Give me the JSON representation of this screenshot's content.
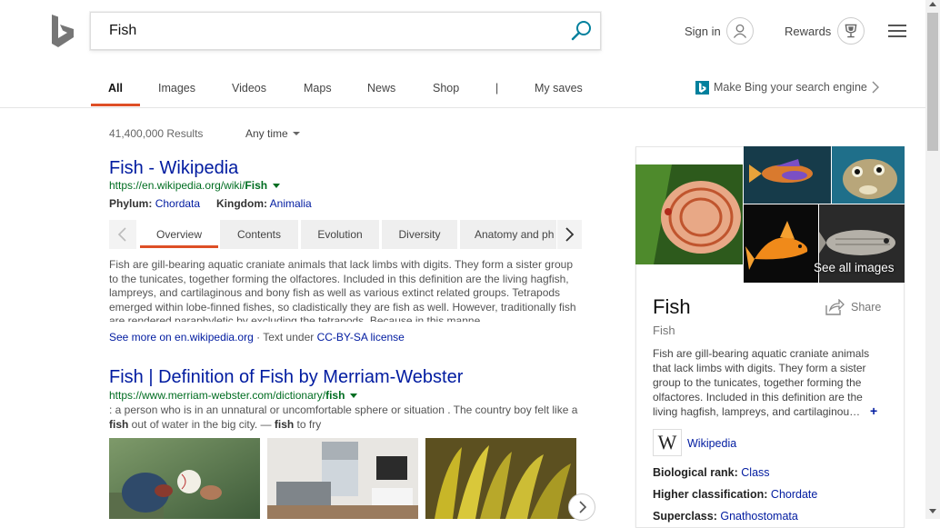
{
  "search": {
    "query": "Fish"
  },
  "header": {
    "signin_label": "Sign in",
    "rewards_label": "Rewards"
  },
  "nav": {
    "tabs": [
      {
        "label": "All",
        "active": true
      },
      {
        "label": "Images"
      },
      {
        "label": "Videos"
      },
      {
        "label": "Maps"
      },
      {
        "label": "News"
      },
      {
        "label": "Shop"
      },
      {
        "label": "|"
      },
      {
        "label": "My saves"
      }
    ],
    "promo_label": "Make Bing your search engine"
  },
  "results_meta": {
    "count": "41,400,000 Results",
    "time_filter": "Any time"
  },
  "result1": {
    "title": "Fish - Wikipedia",
    "url_prefix": "https://en.wikipedia.org/wiki/",
    "url_bold": "Fish",
    "facts": [
      {
        "key": "Phylum:",
        "value": "Chordata"
      },
      {
        "key": "Kingdom:",
        "value": "Animalia"
      }
    ],
    "tabs": [
      "Overview",
      "Contents",
      "Evolution",
      "Diversity",
      "Anatomy and ph"
    ],
    "snippet": "Fish are gill-bearing aquatic craniate animals that lack limbs with digits. They form a sister group to the tunicates, together forming the olfactores. Included in this definition are the living hagfish, lampreys, and cartilaginous and bony fish as well as various extinct related groups. Tetrapods emerged within lobe-finned fishes, so cladistically they are fish as well. However, traditionally fish are rendered paraphyletic by excluding the tetrapods. Because in this manne…",
    "see_more": "See more on en.wikipedia.org",
    "license_text": " · Text under ",
    "license_link": "CC-BY-SA license"
  },
  "result2": {
    "title": "Fish | Definition of Fish by Merriam-Webster",
    "url_prefix": "https://www.merriam-webster.com/dictionary/",
    "url_bold": "fish",
    "snippet_a": ": a person who is in an unnatural or uncomfortable sphere or situation . The country boy felt like a ",
    "snippet_b1": "fish",
    "snippet_c": " out of water in the big city. — ",
    "snippet_b2": "fish",
    "snippet_d": " to fry"
  },
  "panel": {
    "see_all_images": "See all images",
    "title": "Fish",
    "subtitle": "Fish",
    "share_label": "Share",
    "description": "Fish are gill-bearing aquatic craniate animals that lack limbs with digits. They form a sister group to the tunicates, together forming the olfactores. Included in this definition are the living hagfish, lampreys, and cartilaginou…",
    "expand": "+",
    "wiki_icon": "W",
    "wiki_label": "Wikipedia",
    "facts": [
      {
        "key": "Biological rank:",
        "value": "Class"
      },
      {
        "key": "Higher classification:",
        "value": "Chordate"
      },
      {
        "key": "Superclass:",
        "value": "Gnathostomata"
      }
    ]
  },
  "colors": {
    "accent": "#de4f26",
    "link": "#001ba0",
    "url_green": "#006d21",
    "bing_teal": "#00809d"
  },
  "icons": [
    "bing-logo-icon",
    "search-icon",
    "avatar-icon",
    "rewards-trophy-icon",
    "hamburger-menu-icon",
    "chevron-right-icon",
    "share-icon",
    "wikipedia-icon"
  ]
}
